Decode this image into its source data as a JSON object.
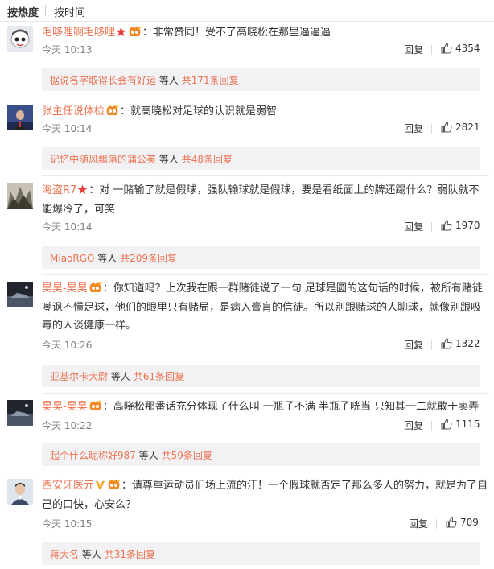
{
  "sort": {
    "hot": "按热度",
    "time": "按时间"
  },
  "comments": [
    {
      "user": "毛哆哩啊毛哆哩",
      "text": "：非常赞同！受不了高晓松在那里逼逼逼",
      "time": "今天 10:13",
      "reply": "回复",
      "likes": "4354",
      "sub_user": "据说名字取得长会有好运",
      "sub_mid": "等人",
      "sub_count": "共171条回复"
    },
    {
      "user": "张主任说体检",
      "text": "：就高晓松对足球的认识就是弱智",
      "time": "今天 10:14",
      "reply": "回复",
      "likes": "2821",
      "sub_user": "记忆中随风飘落的蒲公英",
      "sub_mid": "等人",
      "sub_count": "共48条回复"
    },
    {
      "user": "海盗R7",
      "text": "：对 一赌输了就是假球，强队输球就是假球，要是看纸面上的牌还踢什么？弱队就不能爆冷了，可笑",
      "time": "今天 10:14",
      "reply": "回复",
      "likes": "1970",
      "sub_user": "MiaoRGO",
      "sub_mid": "等人",
      "sub_count": "共209条回复"
    },
    {
      "user": "昊昊-昊昊",
      "text": "：你知道吗？上次我在跟一群赌徒说了一句 足球是圆的这句话的时候，被所有赌徒嘲讽不懂足球，他们的眼里只有赌局，是病入膏肓的信徒。所以别跟赌球的人聊球，就像别跟吸毒的人谈健康一样。",
      "time": "今天 10:26",
      "reply": "回复",
      "likes": "1322",
      "sub_user": "亚基尔卡大尉",
      "sub_mid": "等人",
      "sub_count": "共61条回复"
    },
    {
      "user": "昊昊-昊昊",
      "text": "：高晓松那番话充分体现了什么叫 一瓶子不满 半瓶子咣当 只知其一二就敢于卖弄",
      "time": "今天 10:22",
      "reply": "回复",
      "likes": "1115",
      "sub_user": "起个什么昵称好987",
      "sub_mid": "等人",
      "sub_count": "共59条回复"
    },
    {
      "user": "西安牙医亓",
      "text": "：请尊重运动员们场上流的汗！一个假球就否定了那么多人的努力，就是为了自己的口快，心安么？",
      "time": "今天 10:15",
      "reply": "回复",
      "likes": "709",
      "sub_user": "蒋大名",
      "sub_mid": "等人",
      "sub_count": "共31条回复"
    }
  ],
  "colors": {
    "username": "#eb7350",
    "subbox": "#f2f2f5",
    "meta": "#808080"
  }
}
